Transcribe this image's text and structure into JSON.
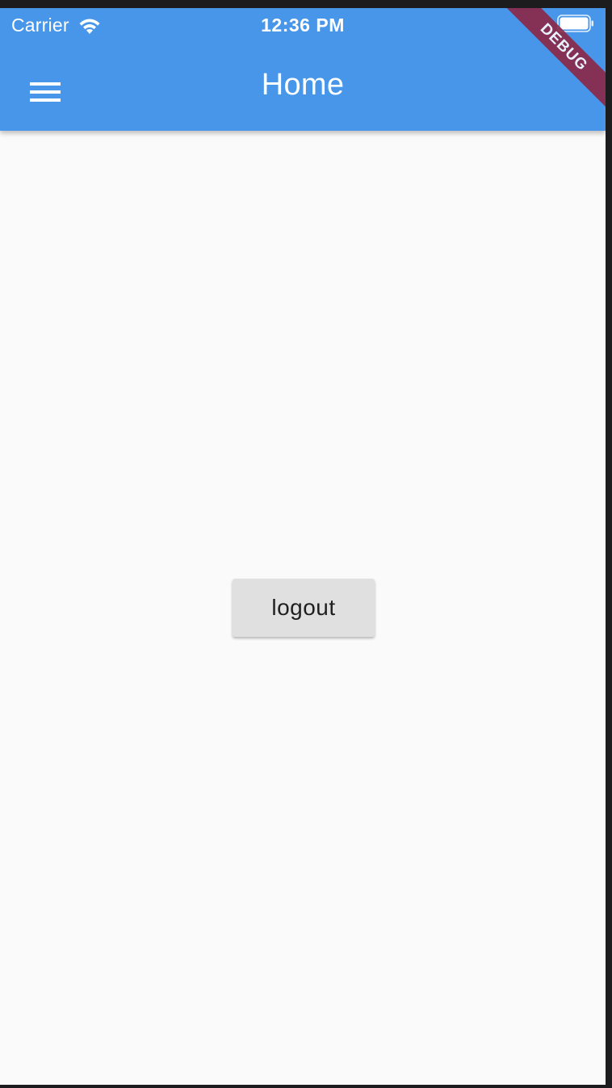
{
  "status_bar": {
    "carrier": "Carrier",
    "time": "12:36 PM"
  },
  "app_bar": {
    "title": "Home",
    "background_color": "#4796ea",
    "menu_icon": "hamburger-icon"
  },
  "debug_banner": {
    "label": "DEBUG",
    "color": "#8d2441"
  },
  "main": {
    "logout_label": "logout",
    "background_color": "#fafafa"
  }
}
